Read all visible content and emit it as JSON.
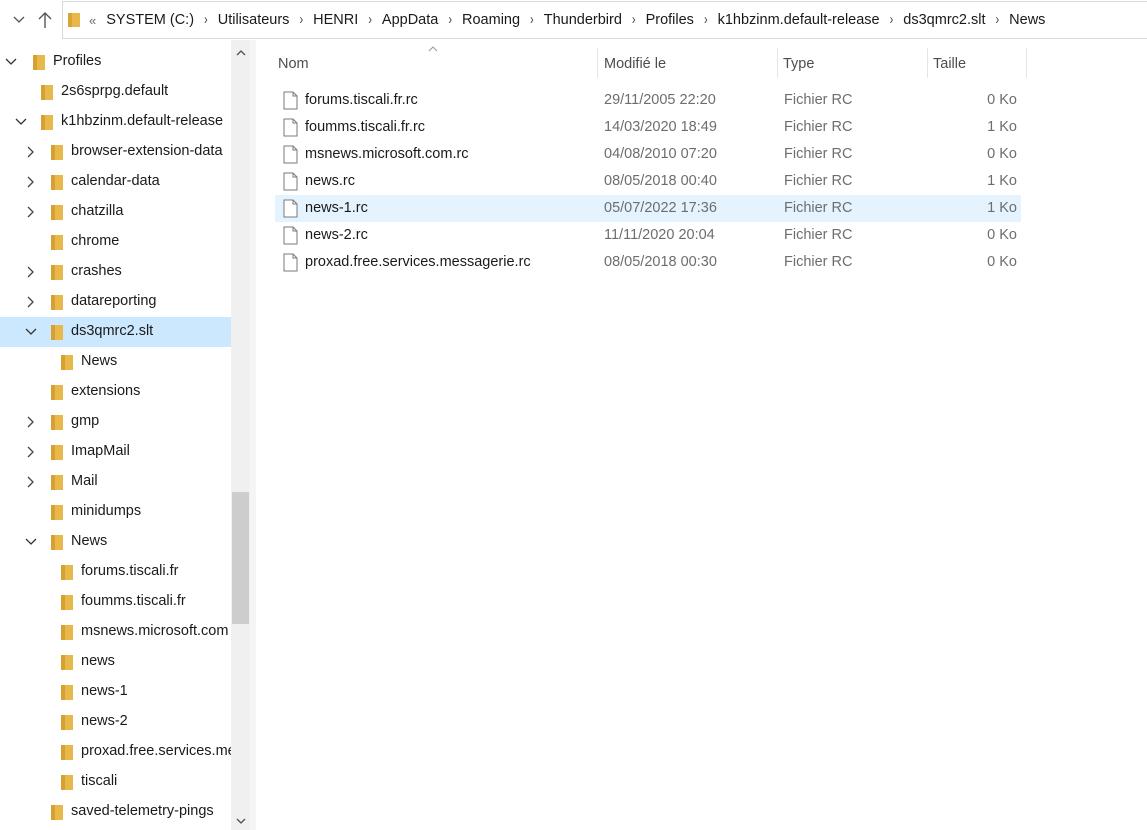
{
  "address_bar": {
    "overflow_glyph": "«",
    "crumbs": [
      "SYSTEM (C:)",
      "Utilisateurs",
      "HENRI",
      "AppData",
      "Roaming",
      "Thunderbird",
      "Profiles",
      "k1hbzinm.default-release",
      "ds3qmrc2.slt",
      "News"
    ]
  },
  "nav_tree": [
    {
      "label": "Profiles",
      "chevron": "down",
      "level": 0
    },
    {
      "label": "2s6sprpg.default",
      "chevron": "",
      "level": 1
    },
    {
      "label": "k1hbzinm.default-release",
      "chevron": "down",
      "level": 1
    },
    {
      "label": "browser-extension-data",
      "chevron": "right",
      "level": 2
    },
    {
      "label": "calendar-data",
      "chevron": "right",
      "level": 2
    },
    {
      "label": "chatzilla",
      "chevron": "right",
      "level": 2
    },
    {
      "label": "chrome",
      "chevron": "",
      "level": 2
    },
    {
      "label": "crashes",
      "chevron": "right",
      "level": 2
    },
    {
      "label": "datareporting",
      "chevron": "right",
      "level": 2
    },
    {
      "label": "ds3qmrc2.slt",
      "chevron": "down",
      "level": 2,
      "selected": true
    },
    {
      "label": "News",
      "chevron": "",
      "level": 3
    },
    {
      "label": "extensions",
      "chevron": "",
      "level": 2
    },
    {
      "label": "gmp",
      "chevron": "right",
      "level": 2
    },
    {
      "label": "ImapMail",
      "chevron": "right",
      "level": 2
    },
    {
      "label": "Mail",
      "chevron": "right",
      "level": 2
    },
    {
      "label": "minidumps",
      "chevron": "",
      "level": 2
    },
    {
      "label": "News",
      "chevron": "down",
      "level": 2
    },
    {
      "label": "forums.tiscali.fr",
      "chevron": "",
      "level": 3
    },
    {
      "label": "foumms.tiscali.fr",
      "chevron": "",
      "level": 3
    },
    {
      "label": "msnews.microsoft.com",
      "chevron": "",
      "level": 3
    },
    {
      "label": "news",
      "chevron": "",
      "level": 3
    },
    {
      "label": "news-1",
      "chevron": "",
      "level": 3
    },
    {
      "label": "news-2",
      "chevron": "",
      "level": 3
    },
    {
      "label": "proxad.free.services.messagerie",
      "chevron": "",
      "level": 3
    },
    {
      "label": "tiscali",
      "chevron": "",
      "level": 3
    },
    {
      "label": "saved-telemetry-pings",
      "chevron": "",
      "level": 2
    }
  ],
  "columns": {
    "name": "Nom",
    "modified": "Modifié le",
    "type": "Type",
    "size": "Taille"
  },
  "files": [
    {
      "name": "forums.tiscali.fr.rc",
      "modified": "29/11/2005 22:20",
      "type": "Fichier RC",
      "size": "0 Ko"
    },
    {
      "name": "foumms.tiscali.fr.rc",
      "modified": "14/03/2020 18:49",
      "type": "Fichier RC",
      "size": "1 Ko"
    },
    {
      "name": "msnews.microsoft.com.rc",
      "modified": "04/08/2010 07:20",
      "type": "Fichier RC",
      "size": "0 Ko"
    },
    {
      "name": "news.rc",
      "modified": "08/05/2018 00:40",
      "type": "Fichier RC",
      "size": "1 Ko"
    },
    {
      "name": "news-1.rc",
      "modified": "05/07/2022 17:36",
      "type": "Fichier RC",
      "size": "1 Ko",
      "selected": true
    },
    {
      "name": "news-2.rc",
      "modified": "11/11/2020 20:04",
      "type": "Fichier RC",
      "size": "0 Ko"
    },
    {
      "name": "proxad.free.services.messagerie.rc",
      "modified": "08/05/2018 00:30",
      "type": "Fichier RC",
      "size": "0 Ko"
    }
  ],
  "colors": {
    "folder": "#e8b84a",
    "nav_selected": "#cce8ff",
    "row_selected": "#e5f3ff"
  }
}
